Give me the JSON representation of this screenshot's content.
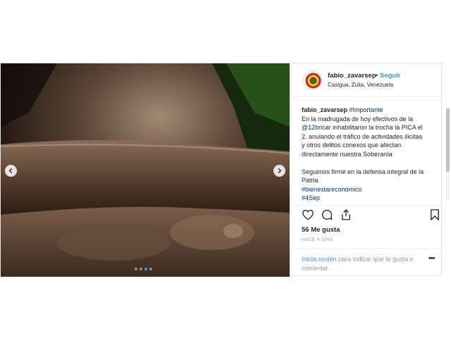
{
  "post": {
    "username": "fabio_zavarsep",
    "separator": "•",
    "follow_label": "Seguir",
    "location": "Casigua, Zulia, Venezuela",
    "caption": {
      "username": "fabio_zavarsep",
      "hashtag_1": "#Importante",
      "line_1": "En la madrugada de hoy efectivos de la",
      "mention": "@12bricar",
      "line_2": " inhabilitaron la trocha la PICA el",
      "line_3": "2. anulando el tráfico de actividades ilícitas",
      "line_4": "y otros delitos conexos que afectan",
      "line_5": "directamente nuestra Soberanía",
      "line_6": "Seguimos firme en la defensa integral de la",
      "line_7": "Patria",
      "hashtag_2": "#bienestareconómico",
      "hashtag_3": "#4Sep"
    },
    "likes": "56 Me gusta",
    "time": "HACE 4 DÍAS",
    "login_link": "Inicia sesión",
    "login_text": " para indicar que te gusta o comentar.",
    "more": "•••",
    "carousel": {
      "count": 4,
      "active_index": 2
    }
  },
  "icons": {
    "prev": "chevron-left-icon",
    "next": "chevron-right-icon",
    "like": "heart-icon",
    "comment": "comment-icon",
    "share": "share-icon",
    "save": "bookmark-icon"
  },
  "colors": {
    "accent": "#3897f0",
    "hashtag": "#003569",
    "muted": "#999999",
    "text": "#262626"
  }
}
